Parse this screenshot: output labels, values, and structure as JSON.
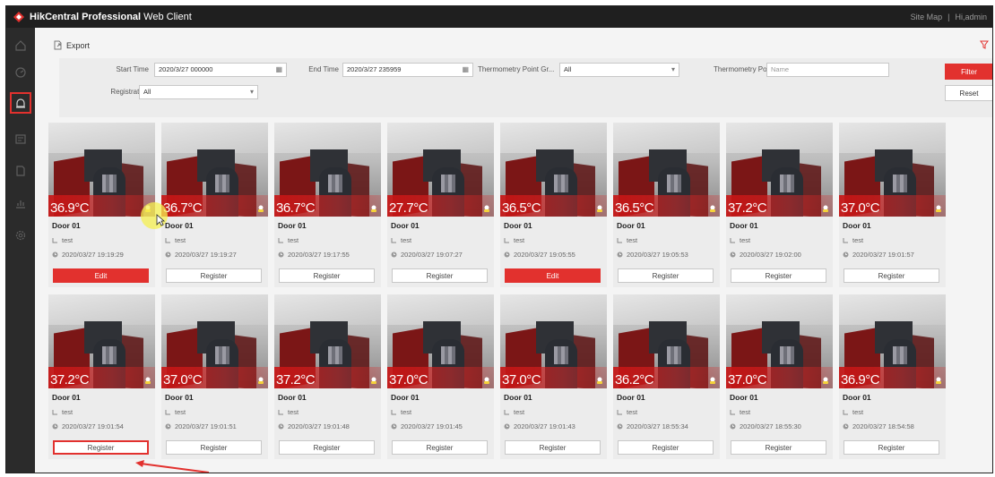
{
  "app": {
    "title_bold": "HikCentral Professional",
    "title_light": "Web Client",
    "site_map": "Site Map",
    "separator": "|",
    "user": "Hi,admin"
  },
  "toolbar": {
    "export_label": "Export"
  },
  "filter": {
    "start_time_label": "Start Time",
    "start_time_value": "2020/3/27 000000",
    "end_time_label": "End Time",
    "end_time_value": "2020/3/27 235959",
    "thermo_group_label": "Thermometry Point Gr...",
    "thermo_group_value": "All",
    "thermo_point_label": "Thermometry Point",
    "thermo_point_placeholder": "Name",
    "registration_label": "Registration",
    "registration_value": "All",
    "filter_button": "Filter",
    "reset_button": "Reset"
  },
  "colors": {
    "accent": "#e2312e",
    "topbar": "#1f1f1f",
    "sidebar": "#2b2b2b"
  },
  "icons": {
    "sidebar": [
      "home-icon",
      "dashboard-icon",
      "alarm-icon",
      "event-icon",
      "report-icon",
      "chart-icon",
      "settings-icon"
    ],
    "card_user": "user-icon",
    "card_time": "clock-icon"
  },
  "cards": [
    {
      "temp": "36.9°C",
      "door": "Door 01",
      "user": "test",
      "time": "2020/03/27 19:19:29",
      "action": "Edit",
      "action_type": "edit"
    },
    {
      "temp": "36.7°C",
      "door": "Door 01",
      "user": "test",
      "time": "2020/03/27 19:19:27",
      "action": "Register",
      "action_type": "register"
    },
    {
      "temp": "36.7°C",
      "door": "Door 01",
      "user": "test",
      "time": "2020/03/27 19:17:55",
      "action": "Register",
      "action_type": "register"
    },
    {
      "temp": "27.7°C",
      "door": "Door 01",
      "user": "test",
      "time": "2020/03/27 19:07:27",
      "action": "Register",
      "action_type": "register"
    },
    {
      "temp": "36.5°C",
      "door": "Door 01",
      "user": "test",
      "time": "2020/03/27 19:05:55",
      "action": "Edit",
      "action_type": "edit"
    },
    {
      "temp": "36.5°C",
      "door": "Door 01",
      "user": "test",
      "time": "2020/03/27 19:05:53",
      "action": "Register",
      "action_type": "register"
    },
    {
      "temp": "37.2°C",
      "door": "Door 01",
      "user": "test",
      "time": "2020/03/27 19:02:00",
      "action": "Register",
      "action_type": "register"
    },
    {
      "temp": "37.0°C",
      "door": "Door 01",
      "user": "test",
      "time": "2020/03/27 19:01:57",
      "action": "Register",
      "action_type": "register"
    },
    {
      "temp": "37.2°C",
      "door": "Door 01",
      "user": "test",
      "time": "2020/03/27 19:01:54",
      "action": "Register",
      "action_type": "register",
      "highlight": true
    },
    {
      "temp": "37.0°C",
      "door": "Door 01",
      "user": "test",
      "time": "2020/03/27 19:01:51",
      "action": "Register",
      "action_type": "register"
    },
    {
      "temp": "37.2°C",
      "door": "Door 01",
      "user": "test",
      "time": "2020/03/27 19:01:48",
      "action": "Register",
      "action_type": "register"
    },
    {
      "temp": "37.0°C",
      "door": "Door 01",
      "user": "test",
      "time": "2020/03/27 19:01:45",
      "action": "Register",
      "action_type": "register"
    },
    {
      "temp": "37.0°C",
      "door": "Door 01",
      "user": "test",
      "time": "2020/03/27 19:01:43",
      "action": "Register",
      "action_type": "register"
    },
    {
      "temp": "36.2°C",
      "door": "Door 01",
      "user": "test",
      "time": "2020/03/27 18:55:34",
      "action": "Register",
      "action_type": "register"
    },
    {
      "temp": "37.0°C",
      "door": "Door 01",
      "user": "test",
      "time": "2020/03/27 18:55:30",
      "action": "Register",
      "action_type": "register"
    },
    {
      "temp": "36.9°C",
      "door": "Door 01",
      "user": "test",
      "time": "2020/03/27 18:54:58",
      "action": "Register",
      "action_type": "register"
    }
  ]
}
